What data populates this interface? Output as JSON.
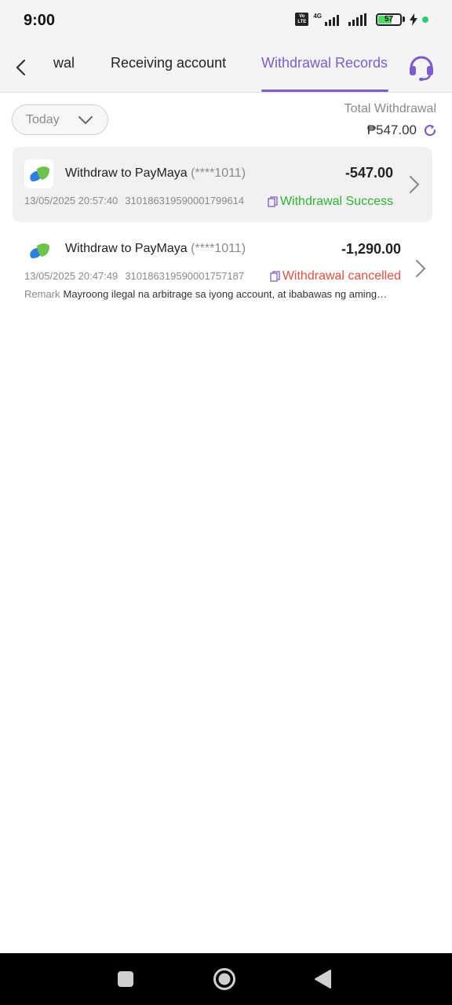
{
  "status_bar": {
    "time": "9:00",
    "volte": "Vo LTE",
    "network": "4G",
    "battery_level": "57",
    "battery_fraction": 0.57,
    "icons": [
      "volte-icon",
      "signal-icon",
      "signal-icon",
      "battery-icon",
      "charging-icon"
    ]
  },
  "header": {
    "back_icon": "chevron-left-icon",
    "tabs": [
      {
        "label": "wal"
      },
      {
        "label": "Receiving account"
      },
      {
        "label": "Withdrawal Records",
        "active": true
      }
    ],
    "support_icon": "headset-icon",
    "accent_color": "#7b5ec9"
  },
  "filter": {
    "period": "Today",
    "total_label": "Total Withdrawal",
    "total_amount": "₱547.00"
  },
  "records": [
    {
      "title": "Withdraw to PayMaya",
      "account": "(****1011)",
      "amount": "-547.00",
      "datetime": "13/05/2025 20:57:40",
      "ref_id": "310186319590001799614",
      "status": "Withdrawal Success",
      "status_color": "#2db32d"
    },
    {
      "title": "Withdraw to PayMaya",
      "account": "(****1011)",
      "amount": "-1,290.00",
      "datetime": "13/05/2025 20:47:49",
      "ref_id": "310186319590001757187",
      "status": "Withdrawal cancelled",
      "status_color": "#e0513e",
      "remark_label": "Remark",
      "remark": "Mayroong ilegal na arbitrage sa iyong account, at ibabawas ng aming…"
    }
  ]
}
